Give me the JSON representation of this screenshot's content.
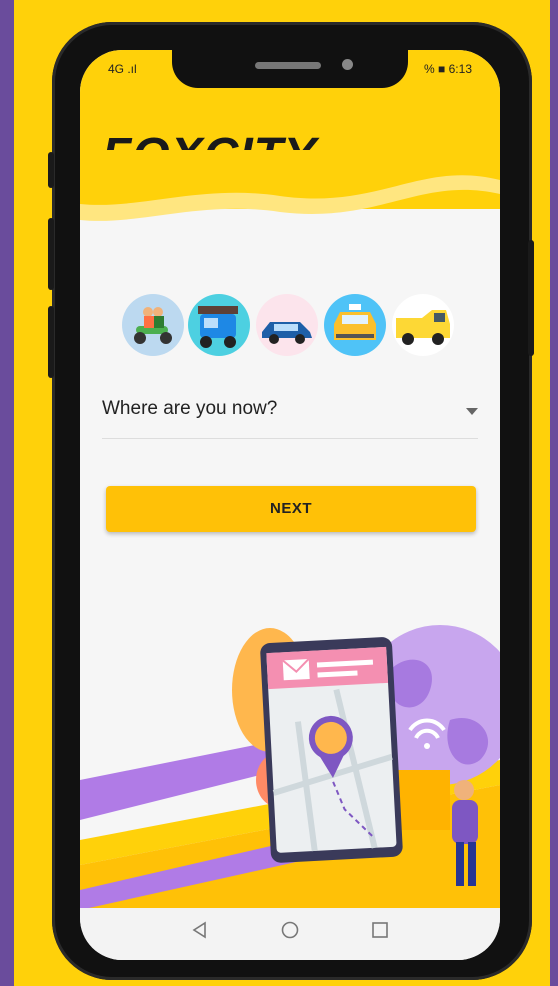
{
  "status_bar": {
    "left": "4G  .ıl",
    "right": "% ■ 6:13"
  },
  "brand": {
    "name": "FOXCITY"
  },
  "vehicles": [
    "scooter-icon",
    "tuktuk-icon",
    "car-icon",
    "taxi-icon",
    "van-icon"
  ],
  "location_select": {
    "placeholder": "Where are you now?"
  },
  "next_button": {
    "label": "NEXT"
  },
  "nav": {
    "back": "back-icon",
    "home": "home-icon",
    "recents": "recents-icon"
  },
  "colors": {
    "accent": "#ffd10a",
    "button": "#ffc107",
    "background": "#6a4c9c",
    "purple": "#b07be6"
  }
}
